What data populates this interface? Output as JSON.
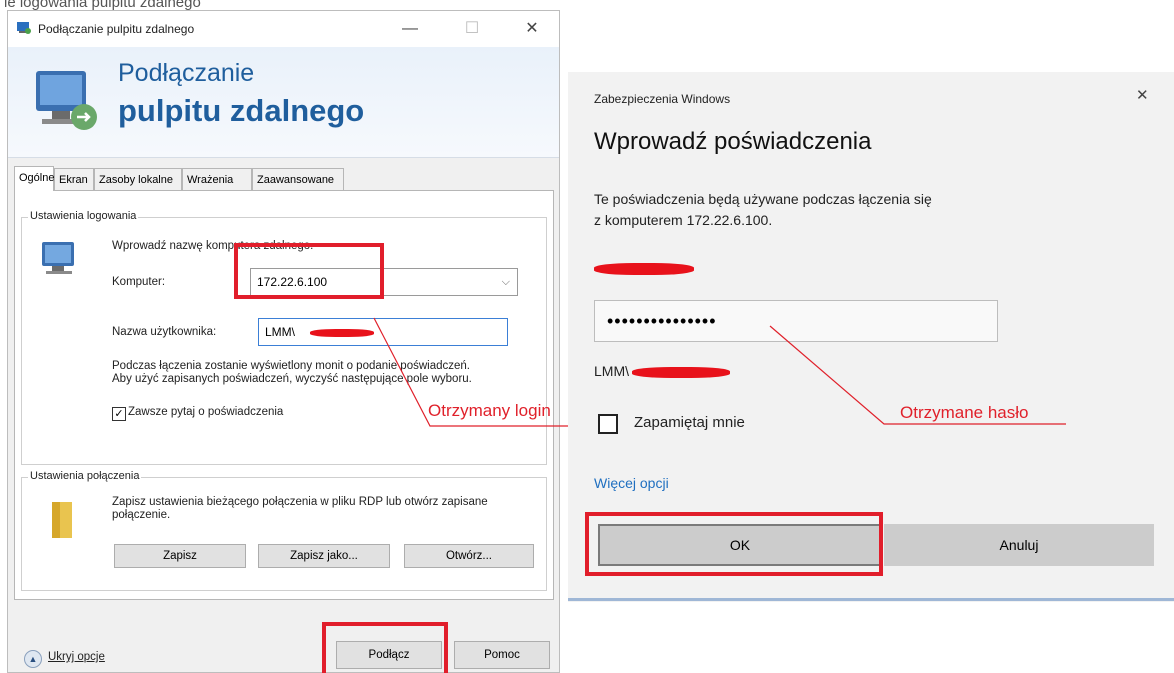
{
  "header_fragment": "ie logowania pulpitu zdalnego",
  "rdc": {
    "title": "Podłączanie pulpitu zdalnego",
    "window_buttons": {
      "minimize": "—",
      "maximize": "☐",
      "close": "✕"
    },
    "banner_line1": "Podłączanie",
    "banner_line2": "pulpitu zdalnego",
    "tabs": [
      "Ogólne",
      "Ekran",
      "Zasoby lokalne",
      "Wrażenia",
      "Zaawansowane"
    ],
    "login_group": {
      "label": "Ustawienia logowania",
      "prompt": "Wprowadź nazwę komputera zdalnego.",
      "computer_label": "Komputer:",
      "computer_value": "172.22.6.100",
      "user_label": "Nazwa użytkownika:",
      "user_value": "LMM\\",
      "info": "Podczas łączenia zostanie wyświetlony monit o podanie poświadczeń. Aby użyć zapisanych poświadczeń, wyczyść następujące pole wyboru.",
      "checkbox_label": "Zawsze pytaj o poświadczenia",
      "checkbox_checked": true
    },
    "connection_group": {
      "label": "Ustawienia połączenia",
      "info": "Zapisz ustawienia bieżącego połączenia w pliku RDP lub otwórz zapisane połączenie.",
      "buttons": [
        "Zapisz",
        "Zapisz jako...",
        "Otwórz..."
      ]
    },
    "hide_options": "Ukryj opcje",
    "connect_button": "Podłącz",
    "help_button": "Pomoc"
  },
  "annotations": {
    "login_note": "Otrzymany login",
    "password_note": "Otrzymane hasło",
    "highlight_color": "#e11e2b"
  },
  "security": {
    "caption": "Zabezpieczenia Windows",
    "close": "✕",
    "heading": "Wprowadź poświadczenia",
    "description_line1": "Te poświadczenia będą używane podczas łączenia się",
    "description_line2": "z komputerem 172.22.6.100.",
    "password_mask": "•••••••••••••••",
    "user_prefix": "LMM\\",
    "remember_label": "Zapamiętaj mnie",
    "more_options": "Więcej opcji",
    "ok_button": "OK",
    "cancel_button": "Anuluj",
    "accent_color": "#1f6fc0"
  }
}
